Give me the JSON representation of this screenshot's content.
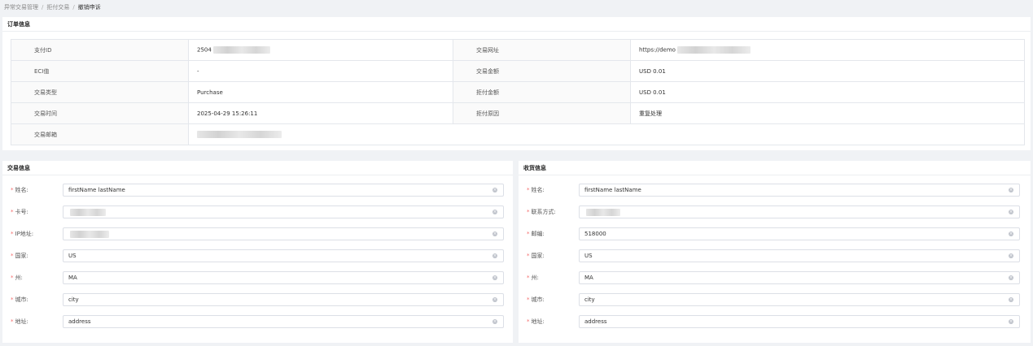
{
  "breadcrumb": {
    "items": [
      "异常交易管理",
      "拒付交易",
      "撤销申诉"
    ],
    "separator": "/"
  },
  "order_info": {
    "title": "订单信息",
    "rows": [
      {
        "l1": "支付ID",
        "v1": "2504",
        "l2": "交易网址",
        "v2": "https://demo"
      },
      {
        "l1": "ECI值",
        "v1": "-",
        "l2": "交易金额",
        "v2": "USD 0.01"
      },
      {
        "l1": "交易类型",
        "v1": "Purchase",
        "l2": "拒付金额",
        "v2": "USD 0.01"
      },
      {
        "l1": "交易时间",
        "v1": "2025-04-29 15:26:11",
        "l2": "拒付原因",
        "v2": "重复处理"
      },
      {
        "l1": "交易邮箱",
        "v1": ""
      }
    ]
  },
  "trade_info": {
    "title": "交易信息",
    "fields": [
      {
        "label": "姓名:",
        "value": "firstName lastName"
      },
      {
        "label": "卡号:",
        "value": ""
      },
      {
        "label": "IP地址:",
        "value": ""
      },
      {
        "label": "国家:",
        "value": "US"
      },
      {
        "label": "州:",
        "value": "MA"
      },
      {
        "label": "城市:",
        "value": "city"
      },
      {
        "label": "地址:",
        "value": "address"
      }
    ]
  },
  "shipping_info": {
    "title": "收货信息",
    "fields": [
      {
        "label": "姓名:",
        "value": "firstName lastName"
      },
      {
        "label": "联系方式:",
        "value": ""
      },
      {
        "label": "邮编:",
        "value": "518000"
      },
      {
        "label": "国家:",
        "value": "US"
      },
      {
        "label": "州:",
        "value": "MA"
      },
      {
        "label": "城市:",
        "value": "city"
      },
      {
        "label": "地址:",
        "value": "address"
      }
    ]
  },
  "colors": {
    "required_star": "#f56c6c",
    "page_bg": "#f0f2f5",
    "border": "#dcdfe6"
  },
  "icons": {
    "clear": "circle-close-icon"
  }
}
